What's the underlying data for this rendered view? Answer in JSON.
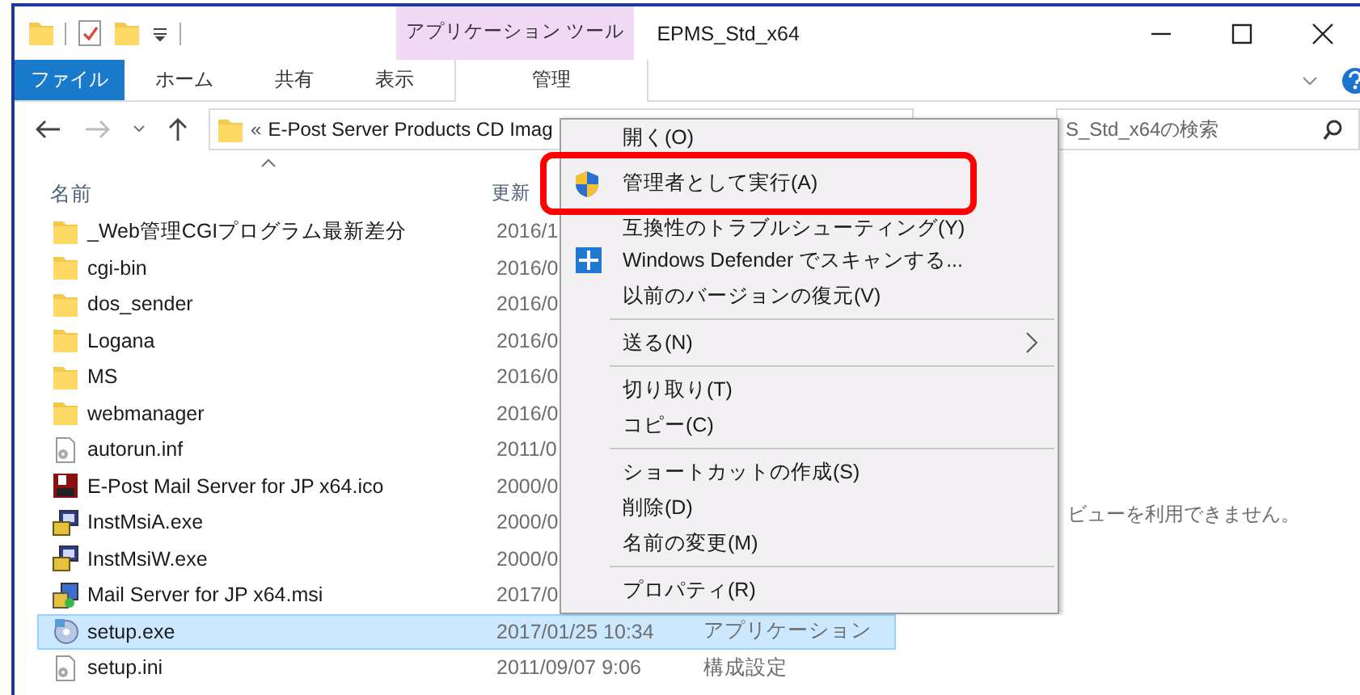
{
  "window": {
    "title": "EPMS_Std_x64"
  },
  "contextual_group": {
    "label": "アプリケーション ツール"
  },
  "ribbon_tabs": [
    {
      "label": "ファイル",
      "kind": "file"
    },
    {
      "label": "ホーム",
      "kind": "plain"
    },
    {
      "label": "共有",
      "kind": "plain"
    },
    {
      "label": "表示",
      "kind": "plain"
    },
    {
      "label": "管理",
      "kind": "contextual"
    }
  ],
  "address": {
    "prefix": "«",
    "path": "E-Post Server Products CD Imag"
  },
  "search": {
    "placeholder": "S_Std_x64の検索"
  },
  "columns": [
    "名前",
    "更新"
  ],
  "files": [
    {
      "name": "_Web管理CGIプログラム最新差分",
      "kind": "folder",
      "modified": "2016/1",
      "selected": false
    },
    {
      "name": "cgi-bin",
      "kind": "folder",
      "modified": "2016/0",
      "selected": false
    },
    {
      "name": "dos_sender",
      "kind": "folder",
      "modified": "2016/0",
      "selected": false
    },
    {
      "name": "Logana",
      "kind": "folder",
      "modified": "2016/0",
      "selected": false
    },
    {
      "name": "MS",
      "kind": "folder",
      "modified": "2016/0",
      "selected": false
    },
    {
      "name": "webmanager",
      "kind": "folder",
      "modified": "2016/0",
      "selected": false
    },
    {
      "name": "autorun.inf",
      "kind": "config",
      "modified": "2011/0",
      "selected": false
    },
    {
      "name": "E-Post Mail Server for JP x64.ico",
      "kind": "image",
      "modified": "2000/0",
      "selected": false
    },
    {
      "name": "InstMsiA.exe",
      "kind": "installer",
      "modified": "2000/0",
      "selected": false
    },
    {
      "name": "InstMsiW.exe",
      "kind": "installer",
      "modified": "2000/0",
      "selected": false
    },
    {
      "name": "Mail Server for JP x64.msi",
      "kind": "package",
      "modified": "2017/0",
      "selected": false
    },
    {
      "name": "setup.exe",
      "kind": "setup",
      "modified": "2017/01/25 10:34",
      "type": "アプリケーション",
      "selected": true
    },
    {
      "name": "setup.ini",
      "kind": "config",
      "modified": "2011/09/07 9:06",
      "type": "構成設定",
      "selected": false
    }
  ],
  "preview_message": "ビューを利用できません。",
  "context_menu": {
    "items": [
      {
        "kind": "plain",
        "label": "開く(O)",
        "highlighted": false
      },
      {
        "kind": "admin",
        "label": "管理者として実行(A)",
        "highlighted": true
      },
      {
        "kind": "plain",
        "label": "互換性のトラブルシューティング(Y)",
        "highlighted": false
      },
      {
        "kind": "scan",
        "label": "Windows Defender でスキャンする...",
        "highlighted": false
      },
      {
        "kind": "plain",
        "label": "以前のバージョンの復元(V)",
        "highlighted": false
      },
      {
        "kind": "separator"
      },
      {
        "kind": "submenu",
        "label": "送る(N)",
        "highlighted": false
      },
      {
        "kind": "separator"
      },
      {
        "kind": "plain",
        "label": "切り取り(T)",
        "highlighted": false
      },
      {
        "kind": "plain",
        "label": "コピー(C)",
        "highlighted": false
      },
      {
        "kind": "separator"
      },
      {
        "kind": "plain",
        "label": "ショートカットの作成(S)",
        "highlighted": false
      },
      {
        "kind": "plain",
        "label": "削除(D)",
        "highlighted": false
      },
      {
        "kind": "plain",
        "label": "名前の変更(M)",
        "highlighted": false
      },
      {
        "kind": "separator"
      },
      {
        "kind": "plain",
        "label": "プロパティ(R)",
        "highlighted": false
      }
    ]
  }
}
